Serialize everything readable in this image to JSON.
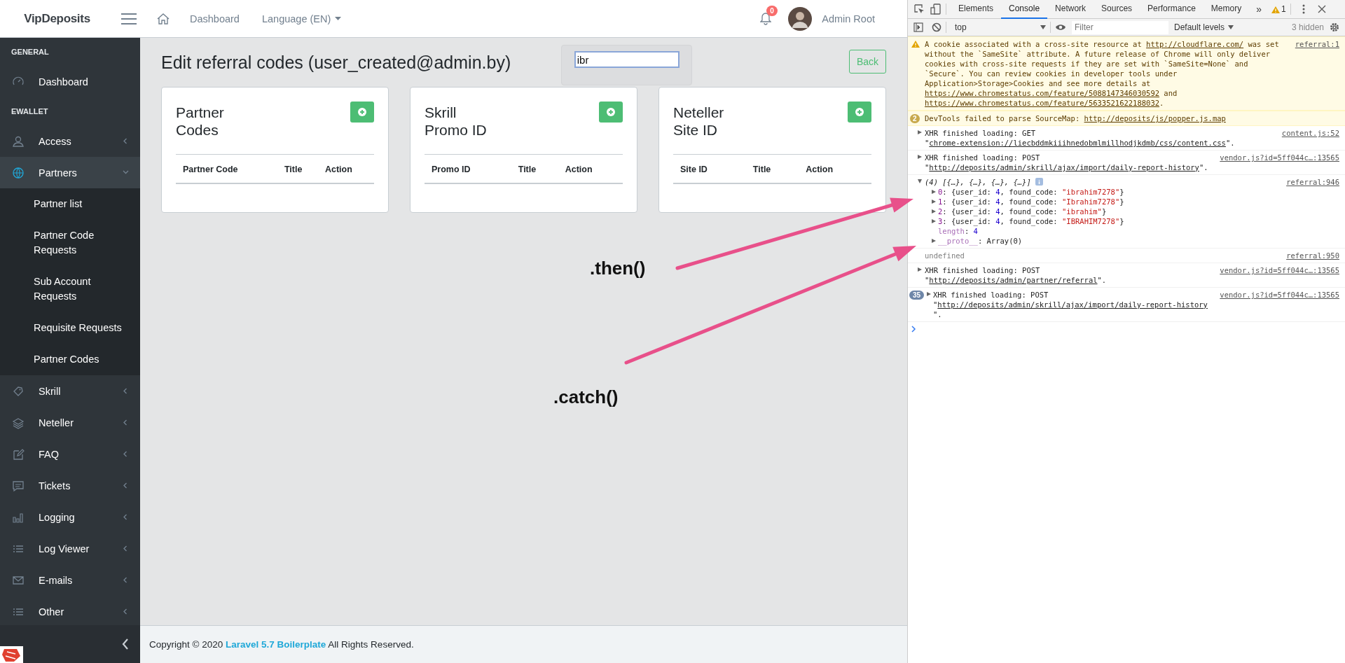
{
  "header": {
    "logo": "VipDeposits",
    "nav": [
      {
        "label": "Dashboard",
        "kind": "link"
      },
      {
        "label": "Language (EN)",
        "kind": "dropdown"
      }
    ],
    "notification_count": "0",
    "user": "Admin Root"
  },
  "sidebar": {
    "sections": [
      {
        "title": "GENERAL",
        "items": [
          {
            "label": "Dashboard",
            "kind": "link"
          }
        ]
      },
      {
        "title": "EWALLET",
        "items": [
          {
            "label": "Access",
            "kind": "group",
            "expanded": false
          },
          {
            "label": "Partners",
            "kind": "group",
            "expanded": true,
            "children": [
              "Partner list",
              "Partner Code Requests",
              "Sub Account Requests",
              "Requisite Requests",
              "Partner Codes"
            ]
          },
          {
            "label": "Skrill",
            "kind": "group",
            "expanded": false
          },
          {
            "label": "Neteller",
            "kind": "group",
            "expanded": false
          },
          {
            "label": "FAQ",
            "kind": "group",
            "expanded": false
          },
          {
            "label": "Tickets",
            "kind": "group",
            "expanded": false
          },
          {
            "label": "Logging",
            "kind": "group",
            "expanded": false
          },
          {
            "label": "Log Viewer",
            "kind": "group",
            "expanded": false
          },
          {
            "label": "E-mails",
            "kind": "group",
            "expanded": false
          },
          {
            "label": "Other",
            "kind": "group",
            "expanded": false
          }
        ]
      }
    ]
  },
  "page": {
    "title": "Edit referral codes (user_created@admin.by)",
    "search": {
      "value": "ibr"
    },
    "back_button": "Back",
    "cards": [
      {
        "title": "Partner Codes",
        "columns": [
          "Partner Code",
          "Title",
          "Action"
        ]
      },
      {
        "title": "Skrill Promo ID",
        "columns": [
          "Promo ID",
          "Title",
          "Action"
        ]
      },
      {
        "title": "Neteller Site ID",
        "columns": [
          "Site ID",
          "Title",
          "Action"
        ]
      }
    ]
  },
  "footer": {
    "prefix": "Copyright © 2020",
    "link": "Laravel 5.7 Boilerplate",
    "suffix": "All Rights Reserved."
  },
  "devtools": {
    "tabs": [
      {
        "label": "Elements",
        "selected": false
      },
      {
        "label": "Console",
        "selected": true
      },
      {
        "label": "Network",
        "selected": false
      },
      {
        "label": "Sources",
        "selected": false
      },
      {
        "label": "Performance",
        "selected": false
      },
      {
        "label": "Memory",
        "selected": false
      }
    ],
    "more": "»",
    "warning_count": "1",
    "context": "top",
    "filter_placeholder": "Filter",
    "levels": "Default levels",
    "hidden": "3 hidden",
    "messages": [
      {
        "kind": "warning",
        "source": "referral:1",
        "segments": [
          {
            "kind": "text",
            "text": "A cookie associated with a cross-site resource at "
          },
          {
            "kind": "link",
            "text": "http://cloudflare.com/"
          },
          {
            "kind": "text",
            "text": " was set without the `SameSite` attribute. A future release of Chrome will only deliver cookies with cross-site requests if they are set with `SameSite=None` and `Secure`. You can review cookies in developer tools under Application>Storage>Cookies and see more details at "
          },
          {
            "kind": "link",
            "text": "https://www.chromestatus.com/feature/5088147346030592"
          },
          {
            "kind": "text",
            "text": " and "
          },
          {
            "kind": "link",
            "text": "https://www.chromestatus.com/feature/5633521622188032"
          },
          {
            "kind": "text",
            "text": "."
          }
        ]
      },
      {
        "kind": "warning",
        "count": "2",
        "segments": [
          {
            "kind": "text",
            "text": "DevTools failed to parse SourceMap: "
          },
          {
            "kind": "link",
            "text": "http://deposits/js/popper.js.map"
          }
        ]
      },
      {
        "kind": "xhr",
        "expanded": false,
        "source": "content.js:52",
        "segments": [
          {
            "kind": "text",
            "text": "XHR finished loading: GET \""
          },
          {
            "kind": "link",
            "text": "chrome-extension://liecbddmkiiihnedobmlmillhodjkdmb/css/content.css"
          },
          {
            "kind": "text",
            "text": "\"."
          }
        ]
      },
      {
        "kind": "xhr",
        "expanded": false,
        "source": "vendor.js?id=5ff044c…:13565",
        "segments": [
          {
            "kind": "text",
            "text": "XHR finished loading: POST \""
          },
          {
            "kind": "link",
            "text": "http://deposits/admin/skrill/ajax/import/daily-report-history"
          },
          {
            "kind": "text",
            "text": "\"."
          }
        ]
      },
      {
        "kind": "object",
        "expanded": true,
        "source": "referral:946",
        "segments": [
          {
            "kind": "italic",
            "text": "(4) [{…}, {…}, {…}, {…}]"
          }
        ],
        "children": [
          {
            "kind": "node",
            "expanded": false,
            "segments": [
              {
                "kind": "key",
                "text": "0"
              },
              {
                "kind": "text",
                "text": ": {user_id: "
              },
              {
                "kind": "number",
                "text": "4"
              },
              {
                "kind": "text",
                "text": ", found_code: "
              },
              {
                "kind": "string",
                "text": "\"ibrahim7278\""
              },
              {
                "kind": "text",
                "text": "}"
              }
            ]
          },
          {
            "kind": "node",
            "expanded": false,
            "segments": [
              {
                "kind": "key",
                "text": "1"
              },
              {
                "kind": "text",
                "text": ": {user_id: "
              },
              {
                "kind": "number",
                "text": "4"
              },
              {
                "kind": "text",
                "text": ", found_code: "
              },
              {
                "kind": "string",
                "text": "\"Ibrahim7278\""
              },
              {
                "kind": "text",
                "text": "}"
              }
            ]
          },
          {
            "kind": "node",
            "expanded": false,
            "segments": [
              {
                "kind": "key",
                "text": "2"
              },
              {
                "kind": "text",
                "text": ": {user_id: "
              },
              {
                "kind": "number",
                "text": "4"
              },
              {
                "kind": "text",
                "text": ", found_code: "
              },
              {
                "kind": "string",
                "text": "\"ibrahim\""
              },
              {
                "kind": "text",
                "text": "}"
              }
            ]
          },
          {
            "kind": "node",
            "expanded": false,
            "segments": [
              {
                "kind": "key",
                "text": "3"
              },
              {
                "kind": "text",
                "text": ": {user_id: "
              },
              {
                "kind": "number",
                "text": "4"
              },
              {
                "kind": "text",
                "text": ", found_code: "
              },
              {
                "kind": "string",
                "text": "\"IBRAHIM7278\""
              },
              {
                "kind": "text",
                "text": "}"
              }
            ]
          },
          {
            "kind": "property",
            "segments": [
              {
                "kind": "dimkey",
                "text": "length"
              },
              {
                "kind": "text",
                "text": ": "
              },
              {
                "kind": "number",
                "text": "4"
              }
            ]
          },
          {
            "kind": "node",
            "expanded": false,
            "segments": [
              {
                "kind": "dimkey",
                "text": "__proto__"
              },
              {
                "kind": "text",
                "text": ": Array(0)"
              }
            ]
          }
        ]
      },
      {
        "kind": "log",
        "source": "referral:950",
        "segments": [
          {
            "kind": "dim",
            "text": "undefined"
          }
        ]
      },
      {
        "kind": "xhr",
        "expanded": false,
        "source": "vendor.js?id=5ff044c…:13565",
        "segments": [
          {
            "kind": "text",
            "text": "XHR finished loading: POST \""
          },
          {
            "kind": "link",
            "text": "http://deposits/admin/partner/referral"
          },
          {
            "kind": "text",
            "text": "\"."
          }
        ]
      },
      {
        "kind": "xhr",
        "expanded": false,
        "count": "35",
        "source": "vendor.js?id=5ff044c…:13565",
        "segments": [
          {
            "kind": "text",
            "text": "XHR finished loading: POST \""
          },
          {
            "kind": "link",
            "text": "http://deposits/admin/skrill/ajax/import/daily-report-history"
          },
          {
            "kind": "text",
            "text": "\"."
          }
        ]
      }
    ]
  },
  "annotations": [
    {
      "text": ".then()"
    },
    {
      "text": ".catch()"
    }
  ]
}
